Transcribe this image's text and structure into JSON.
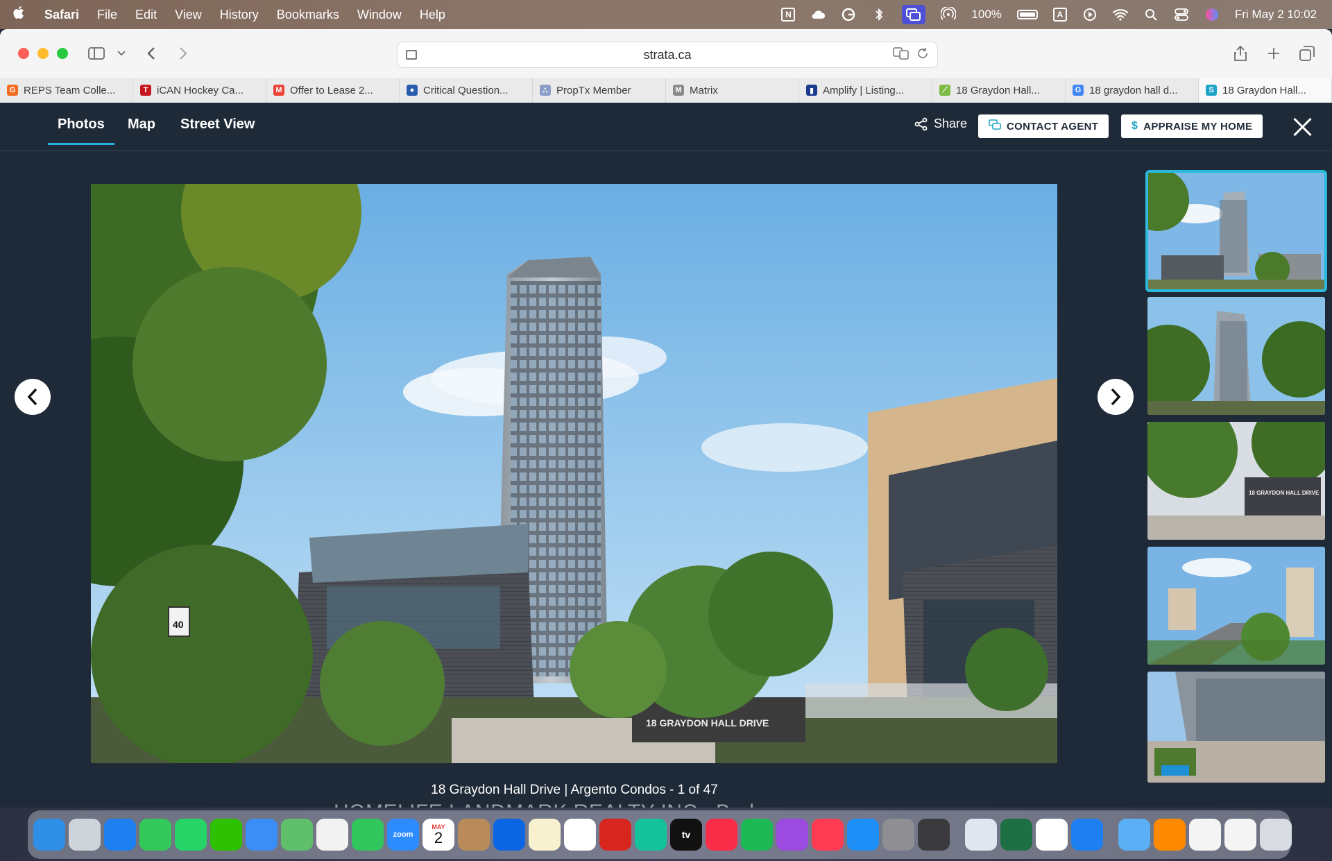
{
  "menubar": {
    "apple": "",
    "app": "Safari",
    "items": [
      "File",
      "Edit",
      "View",
      "History",
      "Bookmarks",
      "Window",
      "Help"
    ],
    "battery_percent": "100%",
    "keyboard_input": "A",
    "clock": "Fri May 2  10:02"
  },
  "browser": {
    "url": "strata.ca",
    "tabs": [
      {
        "label": "REPS Team Colle...",
        "color": "#f26b21",
        "glyph": "G"
      },
      {
        "label": "iCAN Hockey Ca...",
        "color": "#c4161c",
        "glyph": "T"
      },
      {
        "label": "Offer to Lease 2...",
        "color": "#ea4335",
        "glyph": "M"
      },
      {
        "label": "Critical Question...",
        "color": "#2a5db0",
        "glyph": "●"
      },
      {
        "label": "PropTx Member",
        "color": "#8aa0c8",
        "glyph": "∴"
      },
      {
        "label": "Matrix",
        "color": "#8a8a8a",
        "glyph": "M"
      },
      {
        "label": "Amplify | Listing...",
        "color": "#1b3b8f",
        "glyph": "▮"
      },
      {
        "label": "18 Graydon Hall...",
        "color": "#7dbb42",
        "glyph": "⟋"
      },
      {
        "label": "18 graydon hall d...",
        "color": "#4285f4",
        "glyph": "G"
      },
      {
        "label": "18 Graydon Hall...",
        "color": "#1fa3c6",
        "glyph": "S"
      }
    ]
  },
  "listing": {
    "tabs": [
      "Photos",
      "Map",
      "Street View"
    ],
    "share_label": "Share",
    "contact_label": "CONTACT AGENT",
    "appraise_label": "APPRAISE MY HOME",
    "caption": "18 Graydon Hall Drive | Argento Condos - 1 of 47",
    "watermark": "HOMELIFE LANDMARK REALTY INC., Brokerage",
    "photo_sign_text": "18 GRAYDON HALL DRIVE",
    "speed_sign": "40",
    "thumb_sign_text": "18 GRAYDON HALL DRIVE"
  },
  "dock": {
    "calendar_month": "MAY",
    "calendar_day": "2",
    "zoom_label": "zoom",
    "appletv_label": "tv",
    "icons": [
      "finder-icon",
      "launchpad-icon",
      "safari-icon",
      "messages-icon",
      "whatsapp-icon",
      "wechat-icon",
      "mail-icon",
      "maps-icon",
      "photos-icon",
      "facetime-icon",
      "zoom-icon",
      "calendar-icon",
      "contacts-icon",
      "trello-icon",
      "notes-icon",
      "freeform-icon",
      "acrobat-icon",
      "grammarly-icon",
      "appletv-icon",
      "music-icon",
      "spotify-icon",
      "podcasts-icon",
      "news-icon",
      "appstore-icon",
      "settings-icon",
      "iphone-mirroring-icon",
      "preview-icon",
      "excel-icon",
      "notion-icon",
      "safari-icon-2",
      "folder-icon",
      "books-icon",
      "document-icon",
      "document-icon-2",
      "trash-icon"
    ]
  }
}
